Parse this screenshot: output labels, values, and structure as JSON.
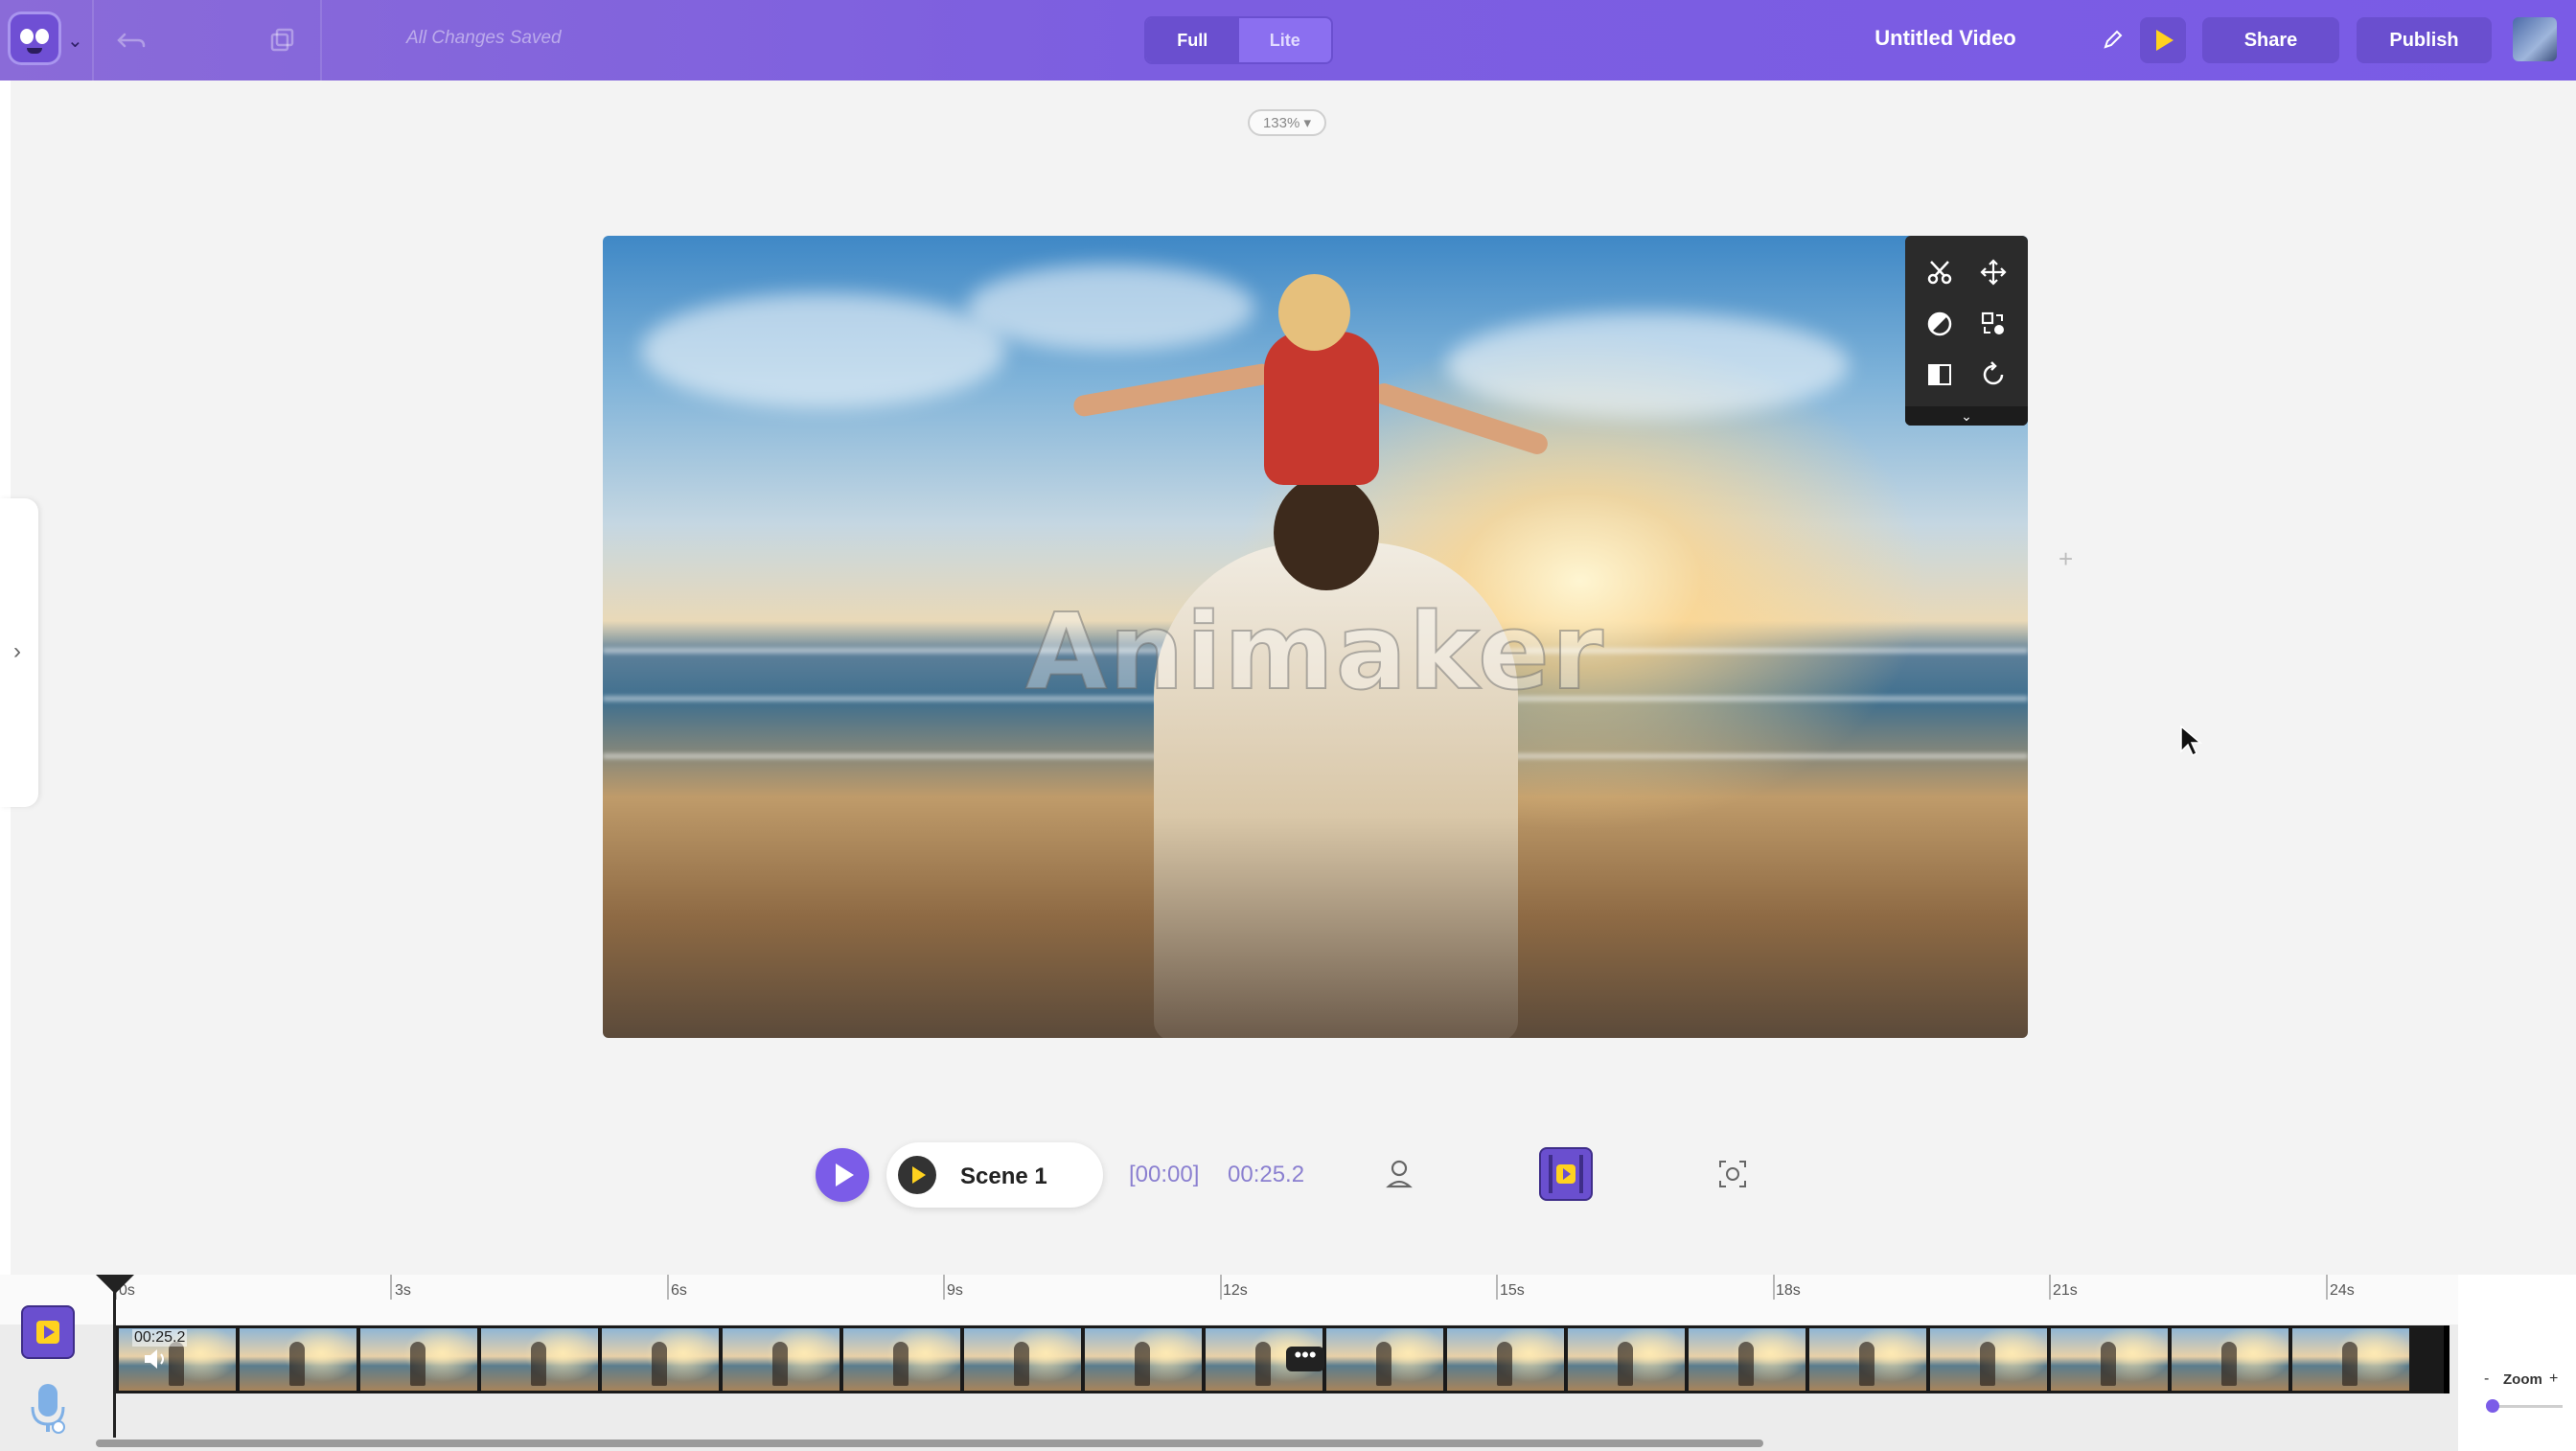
{
  "header": {
    "save_status": "All Changes Saved",
    "mode_full": "Full",
    "mode_lite": "Lite",
    "active_mode": "Full",
    "title": "Untitled Video",
    "share_label": "Share",
    "publish_label": "Publish"
  },
  "canvas": {
    "zoom_level": "133% ▾",
    "watermark": "Animaker",
    "collapse_glyph": "⌄"
  },
  "player": {
    "scene_label": "Scene 1",
    "current_time": "[00:00]",
    "total_time": "00:25.2"
  },
  "timeline": {
    "ticks": [
      "0s",
      "3s",
      "6s",
      "9s",
      "12s",
      "15s",
      "18s",
      "21s",
      "24s"
    ],
    "clip_duration": "00:25.2",
    "more_label": "•••",
    "zoom_label": "Zoom",
    "zoom_minus": "-",
    "zoom_plus": "+"
  },
  "colors": {
    "brand": "#7b5ce8",
    "play_accent": "#ffd21f"
  },
  "icons": [
    "undo-icon",
    "duplicate-icon",
    "pencil-icon",
    "preview-play-icon",
    "scissors-icon",
    "move-icon",
    "filter-icon",
    "swap-icon",
    "flip-icon",
    "rotate-icon",
    "character-icon",
    "video-icon",
    "screenshot-icon",
    "volume-icon",
    "mic-icon"
  ]
}
